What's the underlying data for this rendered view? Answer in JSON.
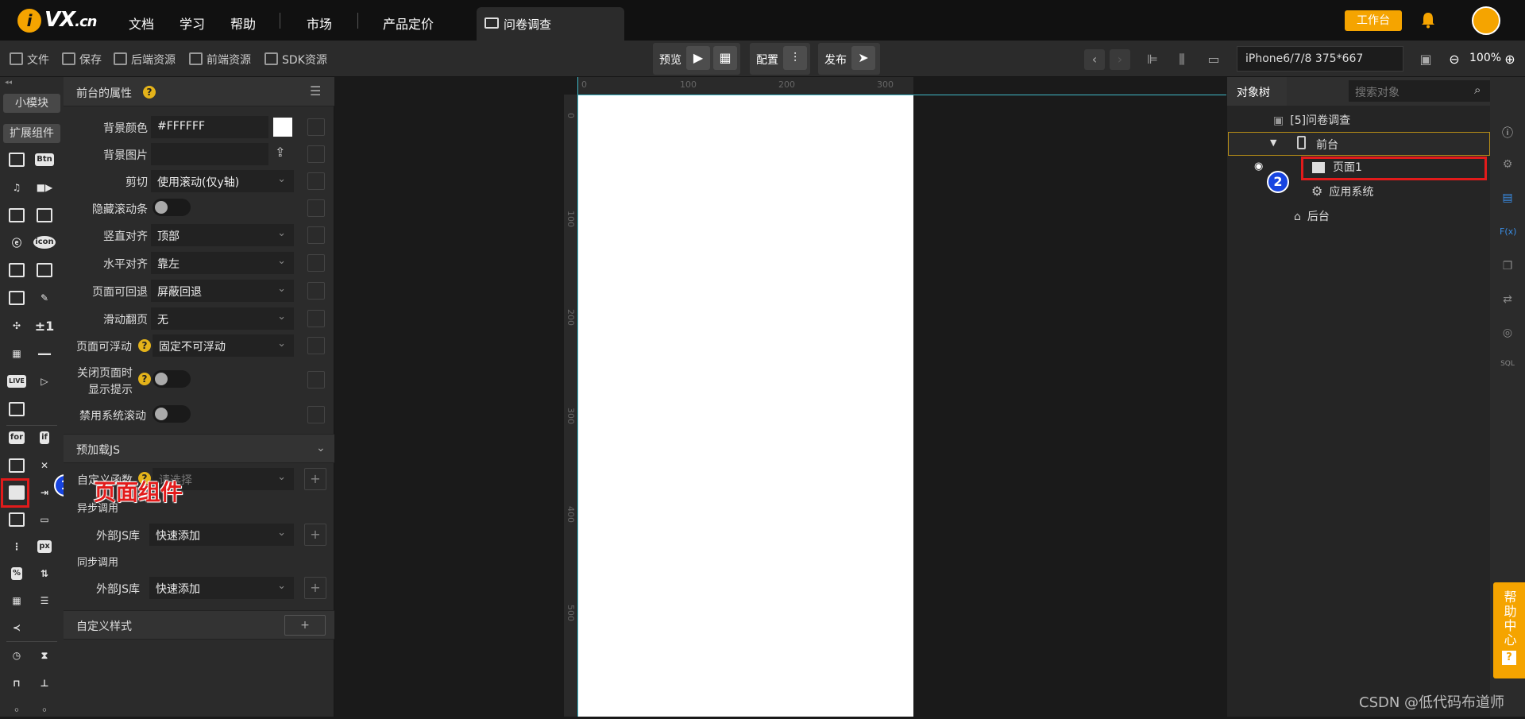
{
  "topnav": {
    "logo_main": "VX",
    "logo_suffix": ".cn",
    "logo_i": "i",
    "links": [
      "文档",
      "学习",
      "帮助",
      "市场",
      "产品定价"
    ],
    "doc_tab": "问卷调查",
    "workbench_button": "工作台",
    "brand_color": "#f5a400"
  },
  "toolbar": {
    "file": "文件",
    "save": "保存",
    "backend_res": "后端资源",
    "frontend_res": "前端资源",
    "sdk_res": "SDK资源",
    "preview": "预览",
    "config": "配置",
    "publish": "发布",
    "device": "iPhone6/7/8 375*667",
    "zoom": "100%"
  },
  "left_col": {
    "collapse_glyph": "◂◂",
    "small_module": "小模块",
    "ext_components": "扩展组件",
    "icon_text": {
      "btn": "Btn",
      "icon": "icon",
      "pm": "±1",
      "live": "LIVE",
      "for": "for",
      "if": "if",
      "px": "px",
      "pct": "%"
    },
    "annotation_1_number": "1",
    "annotation_1_label": "页面组件"
  },
  "props": {
    "title": "前台的属性",
    "help_glyph": "?",
    "menu_glyph": "☰",
    "rows": {
      "bg_color_label": "背景颜色",
      "bg_color_value": "#FFFFFF",
      "bg_image_label": "背景图片",
      "clip_label": "剪切",
      "clip_value": "使用滚动(仅y轴)",
      "hide_scroll_label": "隐藏滚动条",
      "valign_label": "竖直对齐",
      "valign_value": "顶部",
      "halign_label": "水平对齐",
      "halign_value": "靠左",
      "back_label": "页面可回退",
      "back_value": "屏蔽回退",
      "swipe_label": "滑动翻页",
      "swipe_value": "无",
      "float_label": "页面可浮动",
      "float_value": "固定不可浮动",
      "close_tip_label_1": "关闭页面时",
      "close_tip_label_2": "显示提示",
      "disable_scroll_label": "禁用系统滚动"
    },
    "preload_section": "预加载JS",
    "custom_func_label": "自定义函数",
    "custom_func_placeholder": "请选择",
    "async_label": "异步调用",
    "ext_js_label": "外部JS库",
    "ext_js_value": "快速添加",
    "sync_label": "同步调用",
    "ext_js_label_2": "外部JS库",
    "ext_js_value_2": "快速添加",
    "custom_style_section": "自定义样式",
    "plus": "+"
  },
  "canvas": {
    "h_ruler": [
      "0",
      "100",
      "200",
      "300"
    ],
    "v_ruler": [
      "0",
      "100",
      "200",
      "300",
      "400",
      "500"
    ]
  },
  "tree": {
    "tab": "对象树",
    "search_placeholder": "搜索对象",
    "root": "[5]问卷调查",
    "front": "前台",
    "page1": "页面1",
    "app_system": "应用系统",
    "backend": "后台",
    "annotation_2_number": "2"
  },
  "right_icons": [
    "info-icon",
    "settings-icon",
    "chat-icon",
    "fx-icon",
    "copy-icon",
    "swap-icon",
    "db-icon",
    "sql-icon"
  ],
  "right_icon_text": {
    "fx": "F(x)",
    "sql": "SQL"
  },
  "help_center": "帮助中心",
  "help_q": "?",
  "watermark": "CSDN @低代码布道师"
}
